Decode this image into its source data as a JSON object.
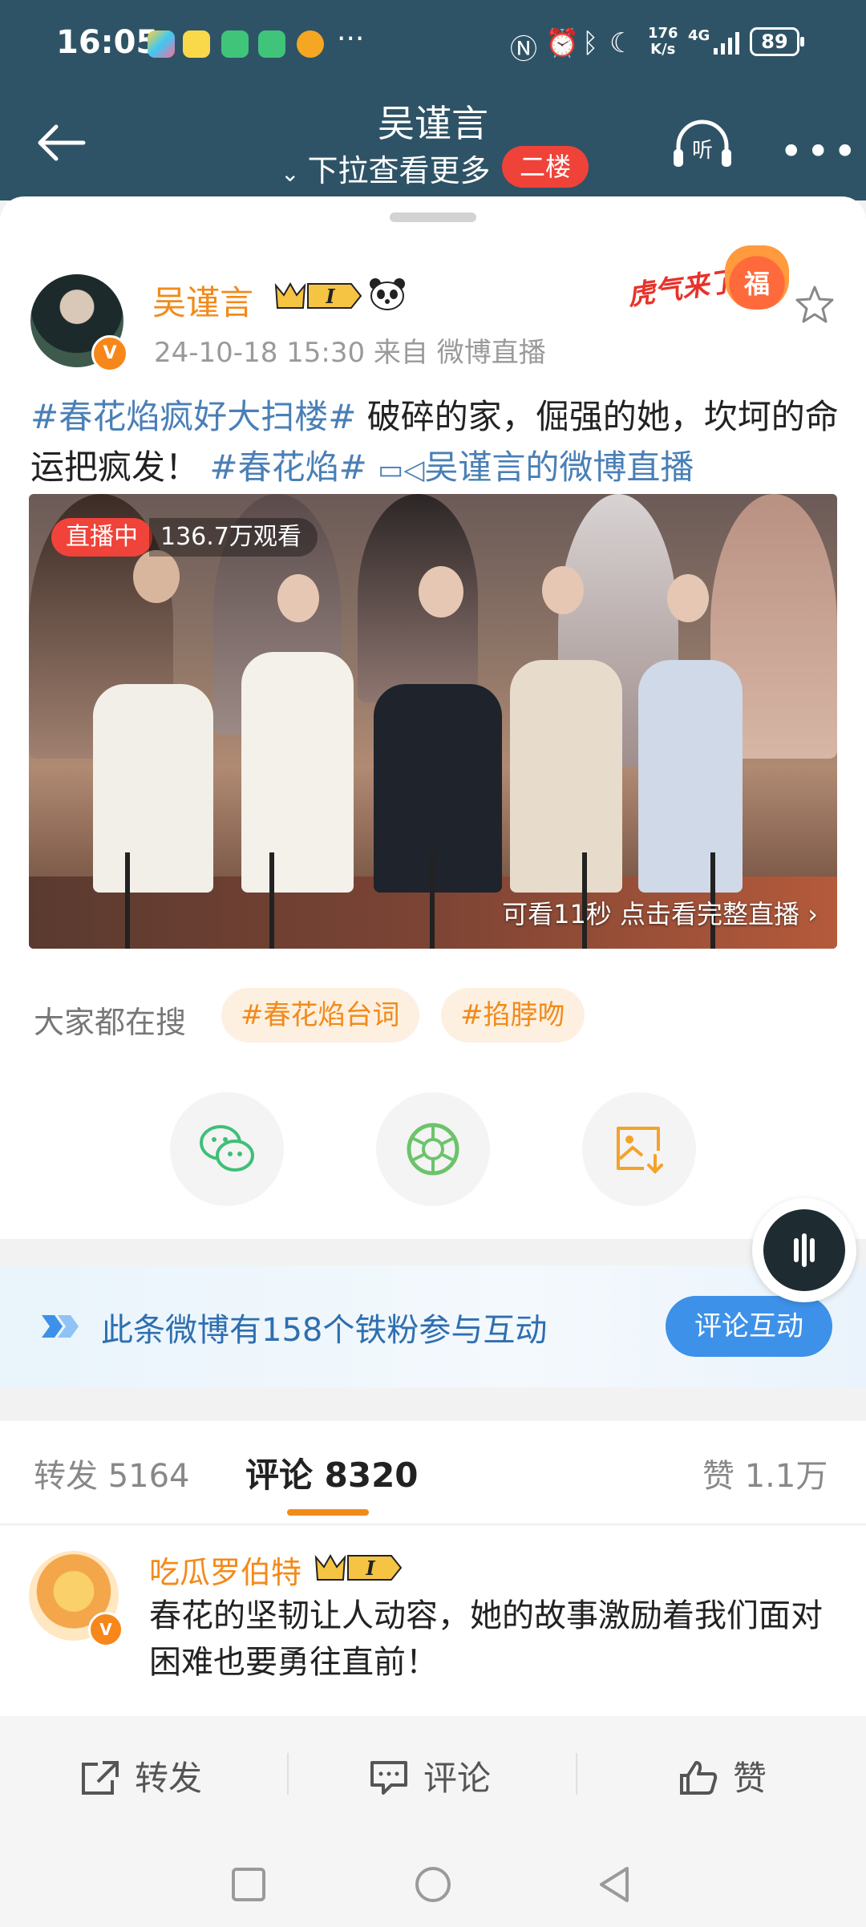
{
  "status_bar": {
    "time": "16:05",
    "more_dots": "···",
    "net_speed_value": "176",
    "net_speed_unit": "K/s",
    "network": "4G",
    "battery": "89"
  },
  "nav": {
    "title": "吴谨言",
    "subtitle": "下拉查看更多",
    "floor_badge": "二楼",
    "listen_label": "听"
  },
  "post": {
    "author": "吴谨言",
    "level_badge": "I",
    "meta": "24-10-18 15:30  来自 微博直播",
    "tiger_badge_text": "虎气来了",
    "tiger_badge_char": "福",
    "text_parts": {
      "tag1": "#春花焰疯好大扫楼#",
      "body": " 破碎的家，倔强的她，坎坷的命运把疯发！",
      "tag2": "#春花焰#",
      "live_link": "吴谨言的微博直播"
    }
  },
  "live": {
    "badge": "直播中",
    "viewers": "136.7万观看",
    "cta": "可看11秒 点击看完整直播 ›"
  },
  "search": {
    "label": "大家都在搜",
    "chips": [
      "#春花焰台词",
      "#掐脖吻"
    ]
  },
  "share_icons": [
    "wechat-icon",
    "moments-icon",
    "save-image-icon"
  ],
  "fans_banner": {
    "text": "此条微博有158个铁粉参与互动",
    "button": "评论互动"
  },
  "tabs": {
    "repost": "转发 5164",
    "comment": "评论 8320",
    "like": "赞 1.1万"
  },
  "comment": {
    "user": "吃瓜罗伯特",
    "level_badge": "I",
    "text": "春花的坚韧让人动容，她的故事激励着我们面对困难也要勇往直前！"
  },
  "actions": {
    "repost": "转发",
    "comment": "评论",
    "like": "赞"
  },
  "colors": {
    "header_bg": "#2f5366",
    "accent_orange": "#f28a1a",
    "link_blue": "#4a7fb6",
    "live_red": "#f0433a",
    "button_blue": "#3d91e8"
  }
}
